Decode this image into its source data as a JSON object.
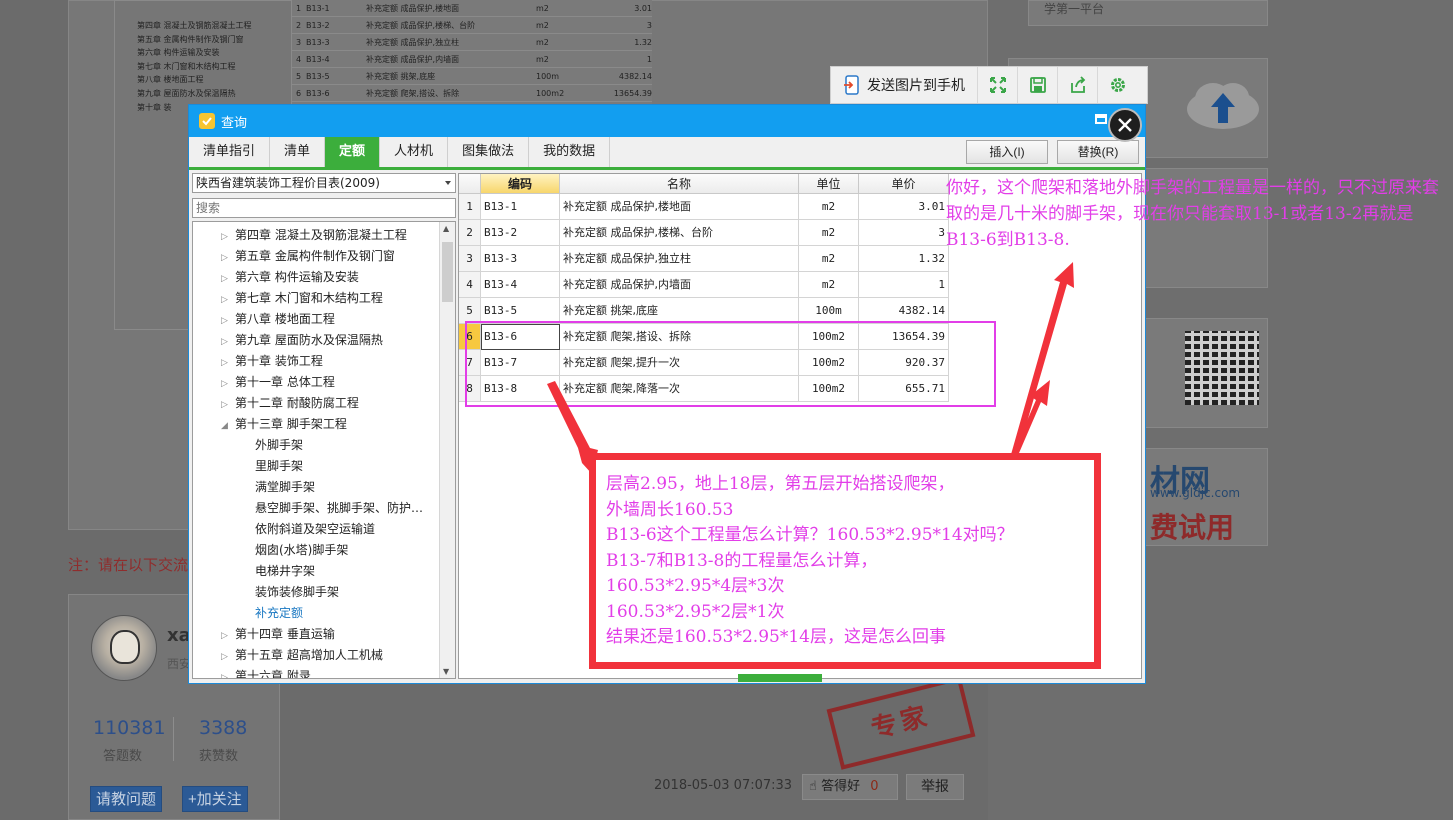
{
  "background": {
    "hint_text": "注：请在以下交流",
    "top_text": "学第一平台",
    "profile": {
      "name": "xa",
      "subtitle": "西安",
      "answers_count": "110381",
      "answers_label": "答题数",
      "likes_count": "3388",
      "likes_label": "获赞数",
      "ask_button": "请教问题",
      "follow_button": "+加关注"
    },
    "meta_time": "2018-05-03 07:07:33",
    "like_label": "答得好",
    "like_count": "0",
    "report_label": "举报",
    "stamp_text": "专家",
    "brand_text": "材网",
    "brand_url": "www.gldjc.com",
    "brand_trial": "费试用",
    "mini_tree": [
      "第四章 混凝土及钢筋混凝土工程",
      "第五章 金属构件制作及钢门窗",
      "第六章 构件运输及安装",
      "第七章 木门窗和木结构工程",
      "第八章 楼地面工程",
      "第九章 屋面防水及保温隔热",
      "第十章 装"
    ],
    "mini_rows": [
      [
        "1",
        "B13-1",
        "补充定额 成品保护,楼地面",
        "m2",
        "3.01"
      ],
      [
        "2",
        "B13-2",
        "补充定额 成品保护,楼梯、台阶",
        "m2",
        "3"
      ],
      [
        "3",
        "B13-3",
        "补充定额 成品保护,独立柱",
        "m2",
        "1.32"
      ],
      [
        "4",
        "B13-4",
        "补充定额 成品保护,内墙面",
        "m2",
        "1"
      ],
      [
        "5",
        "B13-5",
        "补充定额 挑架,底座",
        "100m",
        "4382.14"
      ],
      [
        "6",
        "B13-6",
        "补充定额 爬架,搭设、拆除",
        "100m2",
        "13654.39"
      ]
    ]
  },
  "toolbar": {
    "send_label": "发送图片到手机",
    "icons": [
      "fullscreen-icon",
      "save-icon",
      "share-icon",
      "settings-icon"
    ]
  },
  "dialog": {
    "title": "查询",
    "tabs": [
      {
        "label": "清单指引"
      },
      {
        "label": "清单"
      },
      {
        "label": "定额",
        "active": true
      },
      {
        "label": "人材机"
      },
      {
        "label": "图集做法"
      },
      {
        "label": "我的数据"
      }
    ],
    "insert_button": "插入(I)",
    "replace_button": "替换(R)",
    "combo_value": "陕西省建筑装饰工程价目表(2009)",
    "search_placeholder": "搜索",
    "tree": [
      {
        "label": "第四章 混凝土及钢筋混凝土工程",
        "level": 0,
        "toggle": "▷"
      },
      {
        "label": "第五章 金属构件制作及钢门窗",
        "level": 0,
        "toggle": "▷"
      },
      {
        "label": "第六章 构件运输及安装",
        "level": 0,
        "toggle": "▷"
      },
      {
        "label": "第七章 木门窗和木结构工程",
        "level": 0,
        "toggle": "▷"
      },
      {
        "label": "第八章 楼地面工程",
        "level": 0,
        "toggle": "▷"
      },
      {
        "label": "第九章 屋面防水及保温隔热",
        "level": 0,
        "toggle": "▷"
      },
      {
        "label": "第十章 装饰工程",
        "level": 0,
        "toggle": "▷"
      },
      {
        "label": "第十一章 总体工程",
        "level": 0,
        "toggle": "▷"
      },
      {
        "label": "第十二章 耐酸防腐工程",
        "level": 0,
        "toggle": "▷"
      },
      {
        "label": "第十三章 脚手架工程",
        "level": 0,
        "toggle": "◢"
      },
      {
        "label": "外脚手架",
        "level": 1,
        "toggle": ""
      },
      {
        "label": "里脚手架",
        "level": 1,
        "toggle": ""
      },
      {
        "label": "满堂脚手架",
        "level": 1,
        "toggle": ""
      },
      {
        "label": "悬空脚手架、挑脚手架、防护…",
        "level": 1,
        "toggle": ""
      },
      {
        "label": "依附斜道及架空运输道",
        "level": 1,
        "toggle": ""
      },
      {
        "label": "烟囱(水塔)脚手架",
        "level": 1,
        "toggle": ""
      },
      {
        "label": "电梯井字架",
        "level": 1,
        "toggle": ""
      },
      {
        "label": "装饰装修脚手架",
        "level": 1,
        "toggle": ""
      },
      {
        "label": "补充定额",
        "level": 1,
        "toggle": "",
        "selected": true
      },
      {
        "label": "第十四章 垂直运输",
        "level": 0,
        "toggle": "▷"
      },
      {
        "label": "第十五章 超高增加人工机械",
        "level": 0,
        "toggle": "▷"
      },
      {
        "label": "第十六章 附录",
        "level": 0,
        "toggle": "▷"
      }
    ],
    "grid_headers": {
      "code": "编码",
      "name": "名称",
      "unit": "单位",
      "price": "单价"
    },
    "grid_rows": [
      {
        "idx": "1",
        "code": "B13-1",
        "name": "补充定额 成品保护,楼地面",
        "unit": "m2",
        "price": "3.01"
      },
      {
        "idx": "2",
        "code": "B13-2",
        "name": "补充定额 成品保护,楼梯、台阶",
        "unit": "m2",
        "price": "3"
      },
      {
        "idx": "3",
        "code": "B13-3",
        "name": "补充定额 成品保护,独立柱",
        "unit": "m2",
        "price": "1.32"
      },
      {
        "idx": "4",
        "code": "B13-4",
        "name": "补充定额 成品保护,内墙面",
        "unit": "m2",
        "price": "1"
      },
      {
        "idx": "5",
        "code": "B13-5",
        "name": "补充定额 挑架,底座",
        "unit": "100m",
        "price": "4382.14"
      },
      {
        "idx": "6",
        "code": "B13-6",
        "name": "补充定额 爬架,搭设、拆除",
        "unit": "100m2",
        "price": "13654.39",
        "current": true
      },
      {
        "idx": "7",
        "code": "B13-7",
        "name": "补充定额 爬架,提升一次",
        "unit": "100m2",
        "price": "920.37"
      },
      {
        "idx": "8",
        "code": "B13-8",
        "name": "补充定额 爬架,降落一次",
        "unit": "100m2",
        "price": "655.71"
      }
    ]
  },
  "annotations": {
    "reply": "你好，这个爬架和落地外脚手架的工程量是一样的，只不过原来套取的是几十米的脚手架，现在你只能套取13-1或者13-2再就是B13-6到B13-8.",
    "question_lines": [
      "层高2.95，地上18层，第五层开始搭设爬架，",
      "外墙周长160.53",
      "B13-6这个工程量怎么计算？160.53*2.95*14对吗？",
      "B13-7和B13-8的工程量怎么计算，",
      "160.53*2.95*4层*3次",
      "160.53*2.95*2层*1次",
      "结果还是160.53*2.95*14层，这是怎么回事"
    ],
    "highlight_color": "#e23ee8",
    "box_color": "#f1323b"
  }
}
